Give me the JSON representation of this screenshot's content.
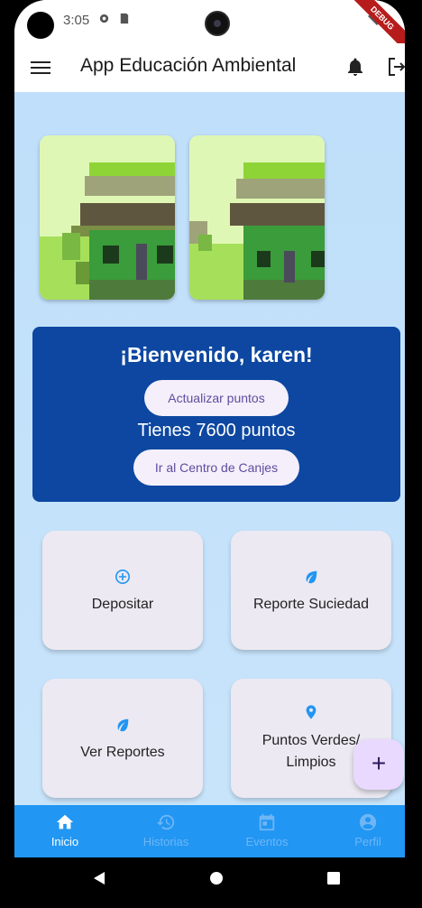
{
  "status_bar": {
    "time": "3:05",
    "debug_banner": "DEBUG"
  },
  "app_bar": {
    "title": "App Educación Ambiental"
  },
  "welcome": {
    "title": "¡Bienvenido, karen!",
    "update_button": "Actualizar puntos",
    "points_text": "Tienes 7600 puntos",
    "exchange_button": "Ir al Centro de Canjes"
  },
  "tiles": [
    {
      "label": "Depositar",
      "icon": "add-circle-icon"
    },
    {
      "label": "Reporte Suciedad",
      "icon": "leaf-icon"
    },
    {
      "label": "Ver Reportes",
      "icon": "leaf-icon"
    },
    {
      "label": "Puntos Verdes/ Limpios",
      "icon": "location-pin-icon"
    }
  ],
  "fab": {
    "label": "+"
  },
  "bottom_nav": [
    {
      "label": "Inicio",
      "icon": "home-icon",
      "active": true
    },
    {
      "label": "Historias",
      "icon": "history-icon",
      "active": false
    },
    {
      "label": "Eventos",
      "icon": "calendar-icon",
      "active": false
    },
    {
      "label": "Perfil",
      "icon": "account-icon",
      "active": false
    }
  ],
  "colors": {
    "primary": "#2196f3",
    "welcome_bg": "#0d47a1",
    "accent_icon": "#2196f3",
    "fab_bg": "#ead9ff"
  }
}
